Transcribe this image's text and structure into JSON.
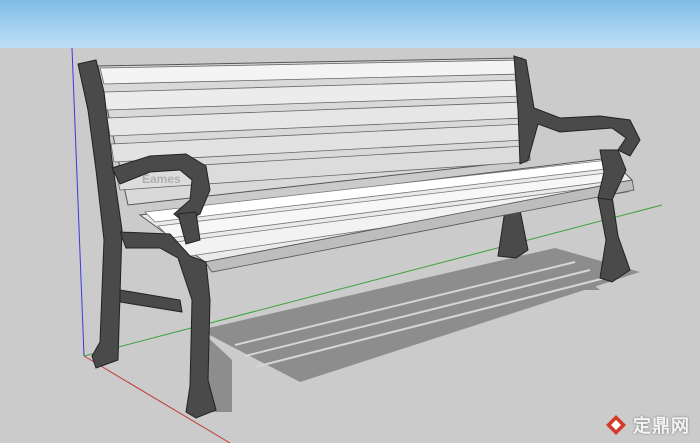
{
  "viewport": {
    "colors": {
      "sky_top": "#7fbde6",
      "sky_bottom": "#bfe0f6",
      "ground": "#cbcbcb",
      "red_axis": "#c23a3a",
      "green_axis": "#3aa33a",
      "blue_axis": "#3c3cd8",
      "frame": "#4a4a4a",
      "slat_light": "#f4f4f4",
      "slat_mid": "#d9d9d9",
      "shadow": "#8d8d8d"
    },
    "model": "park-bench"
  },
  "watermark": {
    "text": "定鼎网",
    "faint_text": "Eames",
    "logo_icon": "diamond-logo-icon",
    "logo_color": "#d43a2a"
  }
}
